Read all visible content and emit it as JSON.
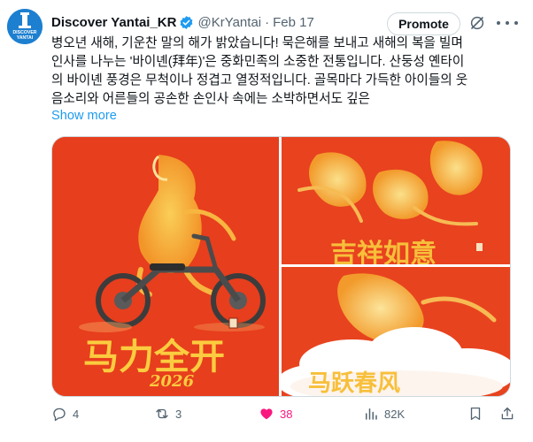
{
  "post": {
    "author_name": "Discover Yantai_KR",
    "handle": "@KrYantai",
    "separator": "·",
    "date": "Feb 17",
    "avatar_text_top": "DISCOVER",
    "avatar_text_bottom": "YANTAI",
    "promote_label": "Promote",
    "text_lines": [
      "병오년 새해, 기운찬 말의 해가 밝았습니다! 묵은해를 보내고 새해의 복을 빌며",
      "인사를 나누는 '바이녠(拜年)'은 중화민족의 소중한 전통입니다. 산둥성 옌타이",
      "의 바이녠 풍경은 무척이나 정겹고 열정적입니다. 골목마다 가득한 아이들의 웃",
      "음소리와 어른들의 공손한 손인사 속에는 소박하면서도 깊은"
    ],
    "show_more": "Show more"
  },
  "media": {
    "image1_calligraphy_line1": "马力全开",
    "image1_calligraphy_line2": "2026",
    "image2_calligraphy": "吉祥如意",
    "image3_calligraphy": "马跃春风",
    "accent_red": "#e73e1d",
    "gold": "#f6a623"
  },
  "actions": {
    "reply_count": "4",
    "repost_count": "3",
    "like_count": "38",
    "views_count": "82K"
  },
  "colors": {
    "link": "#1d9bf0",
    "muted": "#536471",
    "like": "#f91880",
    "verified": "#1d9bf0"
  }
}
